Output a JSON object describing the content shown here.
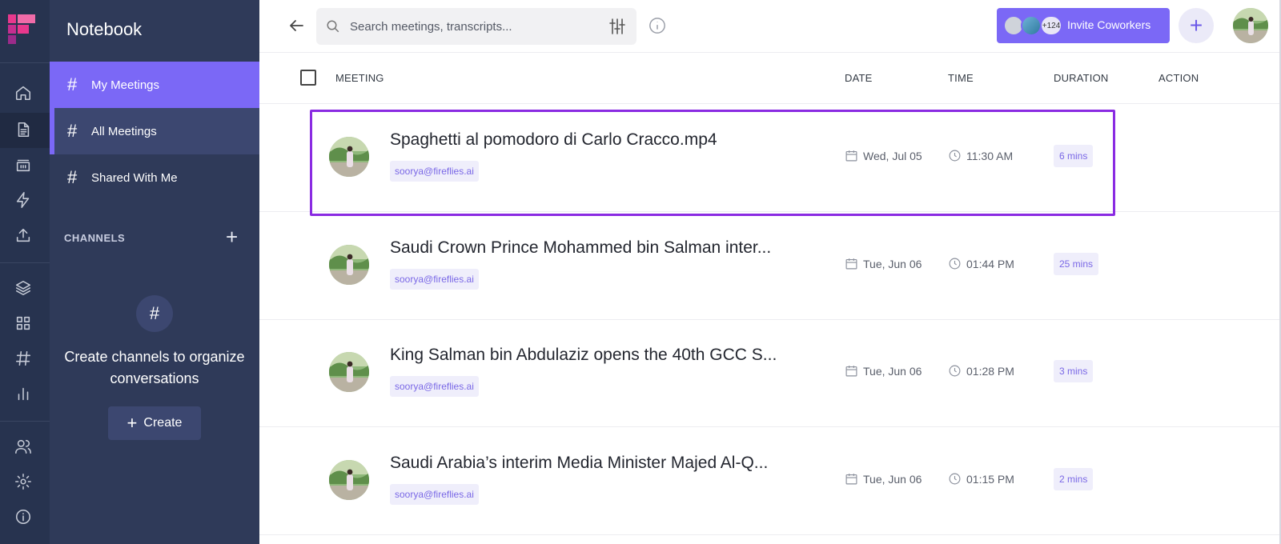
{
  "colors": {
    "accent": "#7b68f6",
    "rail_bg": "#27334f",
    "panel_bg": "#2f3a59",
    "highlight_border": "#8a2be2",
    "badge_bg": "#efeefb",
    "badge_text": "#7a68e6"
  },
  "rail": {
    "icons": [
      "home-icon",
      "document-icon",
      "inbox-icon",
      "lightning-icon",
      "upload-icon",
      "layers-icon",
      "grid-icon",
      "hashtag-icon",
      "bar-chart-icon",
      "users-icon",
      "settings-icon",
      "info-icon"
    ]
  },
  "panel": {
    "title": "Notebook",
    "nav_items": [
      {
        "hash": "#",
        "label": "My Meetings"
      },
      {
        "hash": "#",
        "label": "All Meetings"
      },
      {
        "hash": "#",
        "label": "Shared With Me"
      }
    ],
    "channels_label": "CHANNELS",
    "channels_add": "+",
    "empty_hash": "#",
    "empty_text": "Create channels to organize conversations",
    "create_plus": "+",
    "create_label": "Create"
  },
  "topbar": {
    "search_placeholder": "Search meetings, transcripts...",
    "invite_count": "+124",
    "invite_label": "Invite Coworkers",
    "plus": "+"
  },
  "table": {
    "headers": {
      "meeting": "MEETING",
      "date": "DATE",
      "time": "TIME",
      "duration": "DURATION",
      "action": "ACTION"
    },
    "rows": [
      {
        "title": "Spaghetti al pomodoro di Carlo Cracco.mp4",
        "email": "soorya@fireflies.ai",
        "date": "Wed, Jul 05",
        "time": "11:30 AM",
        "duration": "6 mins"
      },
      {
        "title": "Saudi Crown Prince Mohammed bin Salman inter...",
        "email": "soorya@fireflies.ai",
        "date": "Tue, Jun 06",
        "time": "01:44 PM",
        "duration": "25 mins"
      },
      {
        "title": "King Salman bin Abdulaziz opens the 40th GCC S...",
        "email": "soorya@fireflies.ai",
        "date": "Tue, Jun 06",
        "time": "01:28 PM",
        "duration": "3 mins"
      },
      {
        "title": "Saudi Arabia’s interim Media Minister Majed Al-Q...",
        "email": "soorya@fireflies.ai",
        "date": "Tue, Jun 06",
        "time": "01:15 PM",
        "duration": "2 mins"
      }
    ]
  }
}
